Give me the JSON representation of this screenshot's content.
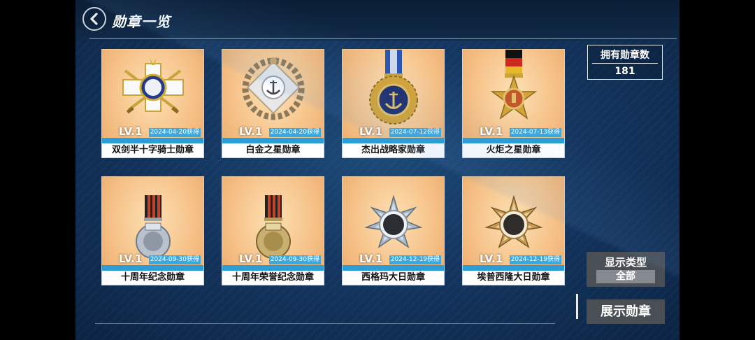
{
  "header": {
    "title": "勋章一览",
    "back_icon": "chevron-left-icon"
  },
  "medal_count": {
    "label": "拥有勋章数",
    "value": "181"
  },
  "filter": {
    "label": "显示类型",
    "value": "全部"
  },
  "show_button": {
    "label": "展示勋章"
  },
  "colors": {
    "card_bg": "#f6c38a",
    "date_bar": "#2c9dd6",
    "panel_bg": "#143660"
  },
  "medals": [
    {
      "name": "双剑半十字骑士勋章",
      "level": "LV.1",
      "date": "2024-04-20获得",
      "icon": "knight-cross-swords-medal-icon"
    },
    {
      "name": "白金之星勋章",
      "level": "LV.1",
      "date": "2024-04-20获得",
      "icon": "platinum-star-anchor-medal-icon"
    },
    {
      "name": "杰出战略家勋章",
      "level": "LV.1",
      "date": "2024-07-12获得",
      "icon": "strategist-anchor-medal-icon"
    },
    {
      "name": "火炬之星勋章",
      "level": "LV.1",
      "date": "2024-07-13获得",
      "icon": "torch-star-medal-icon"
    },
    {
      "name": "十周年纪念勋章",
      "level": "LV.1",
      "date": "2024-09-30获得",
      "icon": "silver-anniversary-medal-icon"
    },
    {
      "name": "十周年荣誉纪念勋章",
      "level": "LV.1",
      "date": "2024-09-30获得",
      "icon": "gold-anniversary-medal-icon"
    },
    {
      "name": "西格玛大日勋章",
      "level": "LV.1",
      "date": "2024-12-19获得",
      "icon": "silver-sun-star-medal-icon"
    },
    {
      "name": "埃普西隆大日勋章",
      "level": "LV.1",
      "date": "2024-12-19获得",
      "icon": "gold-sun-star-medal-icon"
    }
  ]
}
